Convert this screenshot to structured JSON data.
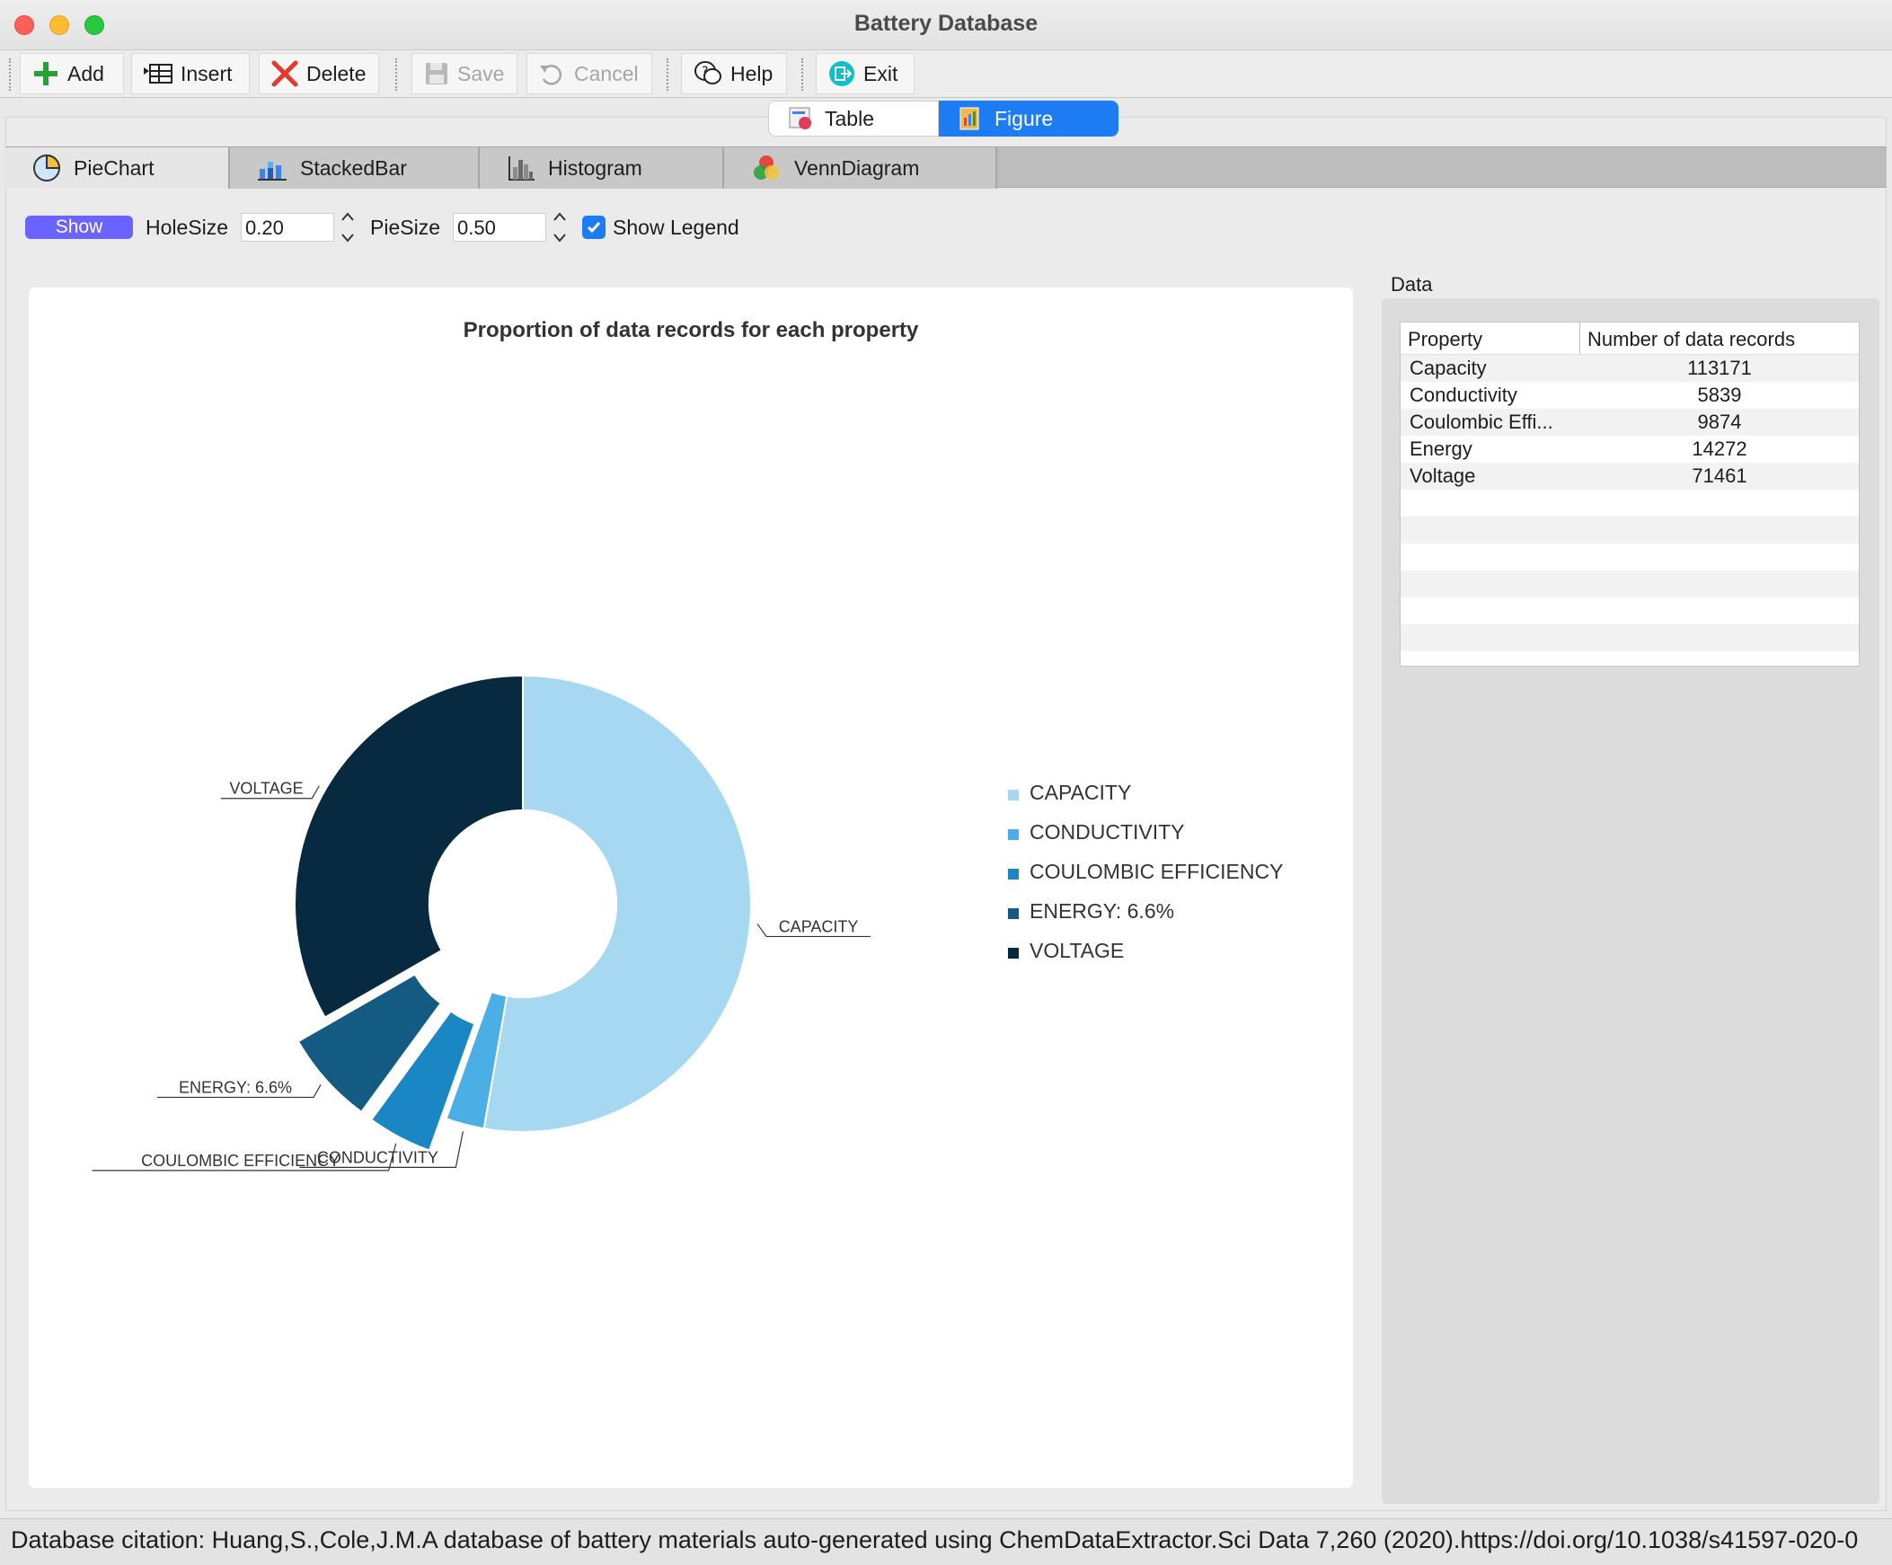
{
  "window": {
    "title": "Battery Database"
  },
  "toolbar": {
    "add": "Add",
    "insert": "Insert",
    "delete": "Delete",
    "save": "Save",
    "cancel": "Cancel",
    "help": "Help",
    "exit": "Exit"
  },
  "view_toggle": {
    "table": "Table",
    "figure": "Figure",
    "selected": "Figure"
  },
  "chart_tabs": {
    "pie": "PieChart",
    "stacked": "StackedBar",
    "histogram": "Histogram",
    "venn": "VennDiagram",
    "selected": "PieChart"
  },
  "options": {
    "show": "Show",
    "hole_size_label": "HoleSize",
    "hole_size_value": "0.20",
    "pie_size_label": "PieSize",
    "pie_size_value": "0.50",
    "legend_label": "Show Legend",
    "legend_checked": true
  },
  "chart_data": {
    "type": "pie",
    "title": "Proportion of data records for each property",
    "hole_size": 0.2,
    "pie_size": 0.5,
    "slices": [
      {
        "label": "CAPACITY",
        "value": 113171,
        "color": "#a6d8f1",
        "exploded": false
      },
      {
        "label": "CONDUCTIVITY",
        "value": 5839,
        "color": "#4bafe6",
        "exploded": false
      },
      {
        "label": "COULOMBIC EFFICIENCY",
        "value": 9874,
        "color": "#1b86c4",
        "exploded": true
      },
      {
        "label": "ENERGY: 6.6%",
        "value": 14272,
        "color": "#135b82",
        "exploded": true
      },
      {
        "label": "VOLTAGE",
        "value": 71461,
        "color": "#072a40",
        "exploded": false
      }
    ],
    "legend": [
      "CAPACITY",
      "CONDUCTIVITY",
      "COULOMBIC EFFICIENCY",
      "ENERGY: 6.6%",
      "VOLTAGE"
    ],
    "legend_position": "right"
  },
  "data_panel": {
    "title": "Data",
    "headers": [
      "Property",
      "Number of data records"
    ],
    "rows": [
      [
        "Capacity",
        "113171"
      ],
      [
        "Conductivity",
        "5839"
      ],
      [
        "Coulombic Effi...",
        "9874"
      ],
      [
        "Energy",
        "14272"
      ],
      [
        "Voltage",
        "71461"
      ]
    ]
  },
  "status": {
    "text": "Database citation:  Huang,S.,Cole,J.M.A database of battery materials auto-generated using ChemDataExtractor.Sci Data 7,260 (2020).https://doi.org/10.1038/s41597-020-0"
  }
}
